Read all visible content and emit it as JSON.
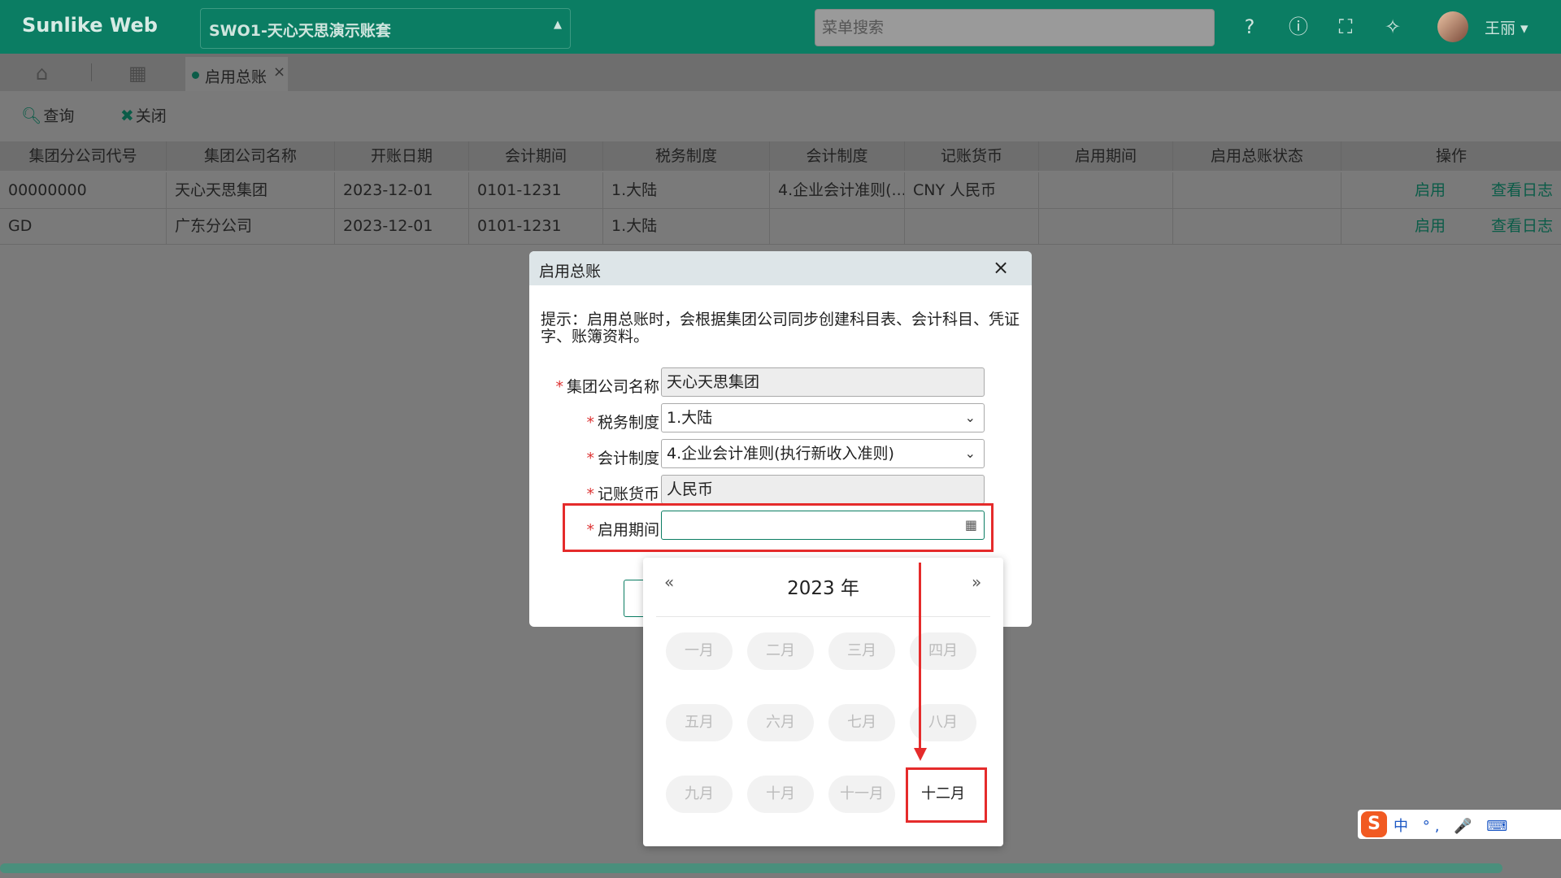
{
  "header": {
    "brand": "Sunlike Web",
    "account_book": "SWO1-天心天思演示账套",
    "search_placeholder": "菜单搜索",
    "user": "王丽",
    "icons": [
      "help-circle-icon",
      "info-icon",
      "fullscreen-icon",
      "broom-icon"
    ]
  },
  "tabs": {
    "active_label": "启用总账"
  },
  "toolbar": {
    "query_label": "查询",
    "close_label": "关闭"
  },
  "table": {
    "columns": [
      "集团分公司代号",
      "集团公司名称",
      "开账日期",
      "会计期间",
      "税务制度",
      "会计制度",
      "记账货币",
      "启用期间",
      "启用总账状态",
      "操作"
    ],
    "rows": [
      {
        "code": "00000000",
        "name": "天心天思集团",
        "open_date": "2023-12-01",
        "period": "0101-1231",
        "tax": "1.大陆",
        "acct": "4.企业会计准则(...",
        "currency": "CNY 人民币",
        "start": "",
        "status": "",
        "act1": "启用",
        "act2": "查看日志"
      },
      {
        "code": "GD",
        "name": "广东分公司",
        "open_date": "2023-12-01",
        "period": "0101-1231",
        "tax": "1.大陆",
        "acct": "",
        "currency": "",
        "start": "",
        "status": "",
        "act1": "启用",
        "act2": "查看日志"
      }
    ]
  },
  "dialog": {
    "title": "启用总账",
    "hint": "提示：启用总账时，会根据集团公司同步创建科目表、会计科目、凭证字、账簿资料。",
    "fields": {
      "company_label": "集团公司名称",
      "company_value": "天心天思集团",
      "tax_label": "税务制度",
      "tax_value": "1.大陆",
      "acct_label": "会计制度",
      "acct_value": "4.企业会计准则(执行新收入准则)",
      "currency_label": "记账货币",
      "currency_value": "人民币",
      "period_label": "启用期间",
      "period_value": ""
    }
  },
  "picker": {
    "year": "2023 年",
    "months": [
      "一月",
      "二月",
      "三月",
      "四月",
      "五月",
      "六月",
      "七月",
      "八月",
      "九月",
      "十月",
      "十一月",
      "十二月"
    ],
    "enabled": "十二月"
  },
  "ime": {
    "text": "中 °, 🎤 ⌨"
  }
}
